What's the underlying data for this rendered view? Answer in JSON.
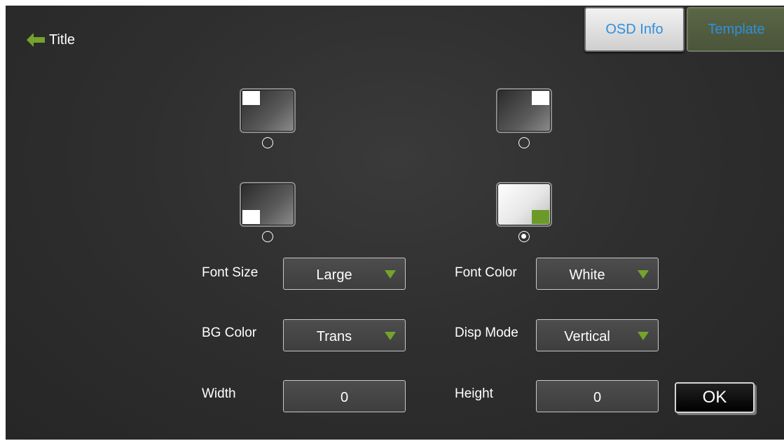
{
  "header": {
    "title": "Title",
    "back_icon": "arrow-left-icon",
    "back_icon_color": "#74a42c"
  },
  "tabs": [
    {
      "label": "OSD Info",
      "active": true
    },
    {
      "label": "Template",
      "active": false
    }
  ],
  "position_options": [
    {
      "id": "top-left",
      "selected": false
    },
    {
      "id": "top-right",
      "selected": false
    },
    {
      "id": "bottom-left",
      "selected": false
    },
    {
      "id": "bottom-right",
      "selected": true
    }
  ],
  "form": {
    "font_size": {
      "label": "Font Size",
      "value": "Large"
    },
    "font_color": {
      "label": "Font Color",
      "value": "White"
    },
    "bg_color": {
      "label": "BG Color",
      "value": "Trans"
    },
    "disp_mode": {
      "label": "Disp Mode",
      "value": "Vertical"
    },
    "width": {
      "label": "Width",
      "value": "0"
    },
    "height": {
      "label": "Height",
      "value": "0"
    },
    "ok_label": "OK"
  },
  "colors": {
    "accent_green": "#74a42c",
    "tab_text_blue": "#2f8fdd",
    "background": "#2f2f2f"
  }
}
